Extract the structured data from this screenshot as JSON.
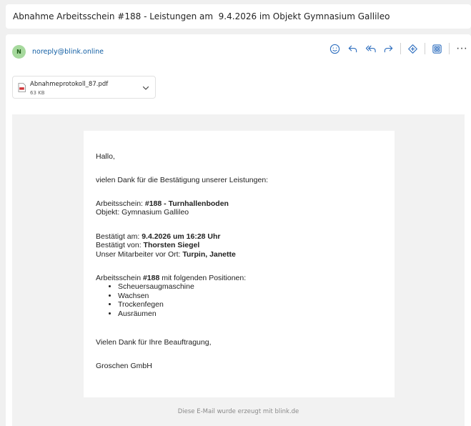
{
  "subject": "Abnahme Arbeitsschein #188 - Leistungen am  9.4.2026 im Objekt Gymnasium Gallileo",
  "sender": {
    "avatar_letter": "N",
    "address": "noreply@blink.online",
    "avatar_color": "#a6d99d"
  },
  "toolbar": {
    "icons": [
      "emoji-icon",
      "reply-icon",
      "reply-all-icon",
      "forward-icon",
      "immersive-reader-icon",
      "apps-icon",
      "more-icon"
    ],
    "accent": "#2f6fbf",
    "more_label": "···"
  },
  "attachment": {
    "name": "Abnahmeprotokoll_87.pdf",
    "size": "63 KB"
  },
  "body": {
    "greeting": "Hallo,",
    "thanks": "vielen Dank für die Bestätigung unserer Leistungen:",
    "arbeitsschein_label": "Arbeitsschein: ",
    "arbeitsschein_value": "#188 - Turnhallenboden",
    "objekt": "Objekt: Gymnasium Gallileo",
    "bestaetigt_am_label": "Bestätigt am: ",
    "bestaetigt_am_value": "9.4.2026 um 16:28 Uhr",
    "bestaetigt_von_label": "Bestätigt von: ",
    "bestaetigt_von_value": "Thorsten Siegel",
    "mitarbeiter_label": "Unser Mitarbeiter vor Ort: ",
    "mitarbeiter_value": "Turpin, Janette",
    "positions_prefix": "Arbeitsschein ",
    "positions_number": "#188",
    "positions_suffix": " mit folgenden Positionen:",
    "positions": [
      "Scheuersaugmaschine",
      "Wachsen",
      "Trockenfegen",
      "Ausräumen"
    ],
    "closing": "Vielen Dank für Ihre Beauftragung,",
    "signature": "Groschen GmbH"
  },
  "footer": "Diese E-Mail wurde erzeugt mit blink.de"
}
